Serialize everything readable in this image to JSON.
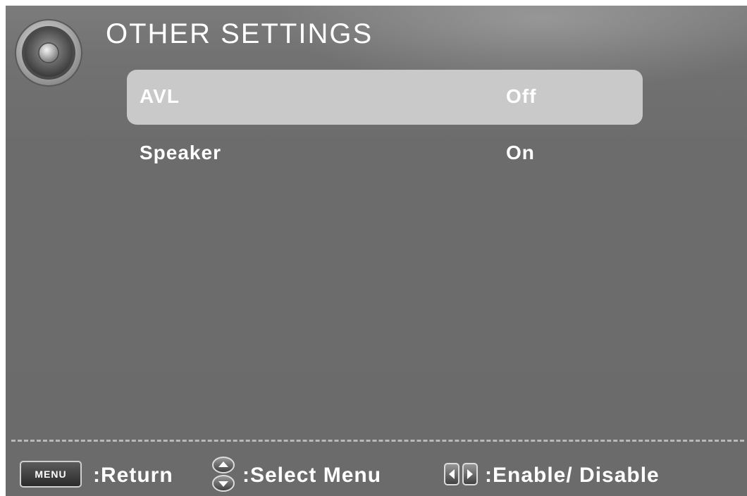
{
  "header": {
    "title": "OTHER SETTINGS",
    "icon": "speaker-icon"
  },
  "menu": {
    "items": [
      {
        "label": "AVL",
        "value": "Off",
        "selected": true
      },
      {
        "label": "Speaker",
        "value": "On",
        "selected": false
      }
    ]
  },
  "footer": {
    "menu_key": "MENU",
    "return_label": ":Return",
    "select_label": ":Select Menu",
    "enable_label": ":Enable/ Disable",
    "icons": [
      "menu-key-icon",
      "up-down-arrows-icon",
      "left-right-arrows-icon"
    ]
  },
  "colors": {
    "background": "#6c6c6c",
    "highlight": "#c9c9c9",
    "text": "#ffffff"
  }
}
